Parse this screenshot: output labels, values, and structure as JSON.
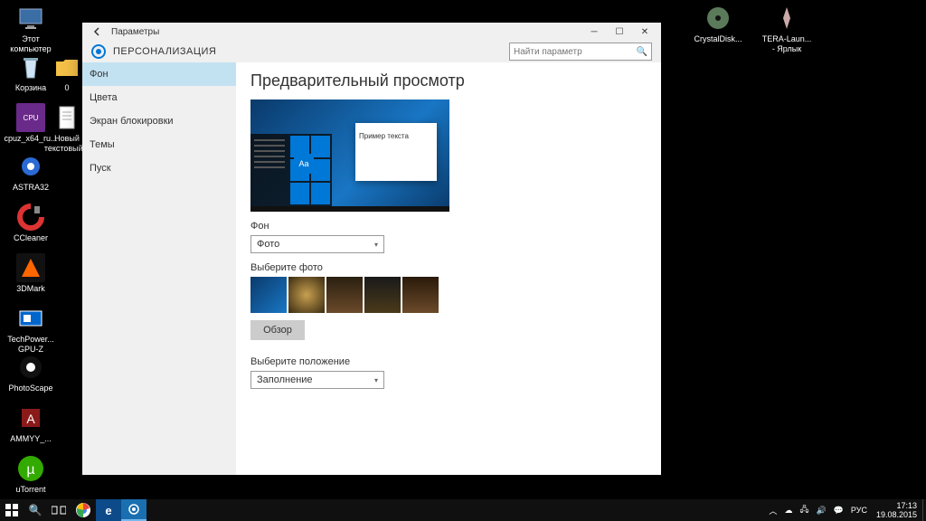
{
  "desktop": {
    "icons_left_col1": [
      {
        "label": "Этот\nкомпьютер"
      },
      {
        "label": "Корзина"
      },
      {
        "label": "cpuz_x64_ru..."
      },
      {
        "label": "ASTRA32"
      },
      {
        "label": "CCleaner"
      },
      {
        "label": "3DMark"
      },
      {
        "label": "TechPower...\nGPU-Z"
      },
      {
        "label": "PhotoScape"
      },
      {
        "label": "AMMYY_..."
      },
      {
        "label": "uTorrent"
      }
    ],
    "icons_left_col2": [
      {
        "label": "0"
      },
      {
        "label": "Новый\nтекстовый..."
      }
    ],
    "icons_right": [
      {
        "label": "CrystalDisk..."
      },
      {
        "label": "TERA-Laun...\n- Ярлык"
      }
    ]
  },
  "settings": {
    "titlebar_label": "Параметры",
    "header_title": "ПЕРСОНАЛИЗАЦИЯ",
    "search_placeholder": "Найти параметр",
    "sidebar": [
      "Фон",
      "Цвета",
      "Экран блокировки",
      "Темы",
      "Пуск"
    ],
    "active_sidebar_index": 0,
    "content": {
      "preview_title": "Предварительный просмотр",
      "preview_sample_text": "Пример текста",
      "preview_aa": "Aa",
      "bg_label": "Фон",
      "bg_dropdown_value": "Фото",
      "choose_photo_label": "Выберите фото",
      "browse_button": "Обзор",
      "fit_label": "Выберите положение",
      "fit_dropdown_value": "Заполнение"
    }
  },
  "taskbar": {
    "time": "17:13",
    "date": "19.08.2015",
    "lang": "РУС"
  }
}
